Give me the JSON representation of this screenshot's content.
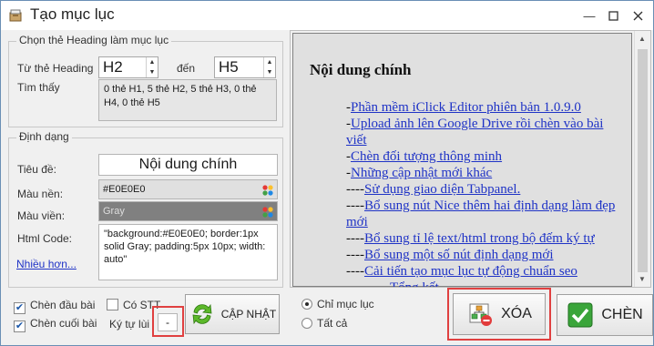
{
  "window": {
    "title": "Tạo mục lục",
    "minimize_icon": "minimize-icon",
    "maximize_icon": "maximize-icon",
    "close_icon": "close-icon"
  },
  "heading_group": {
    "legend": "Chọn thẻ Heading làm mục lục",
    "from_label": "Từ thẻ Heading",
    "from_value": "H2",
    "to_label": "đến",
    "to_value": "H5",
    "found_label": "Tìm thấy",
    "found_text": "0 thẻ H1, 5 thẻ H2, 5 thẻ H3, 0 thẻ H4, 0 thẻ H5"
  },
  "format_group": {
    "legend": "Định dạng",
    "title_label": "Tiêu đề:",
    "title_value": "Nội dung chính",
    "bg_label": "Màu nền:",
    "bg_value": "#E0E0E0",
    "border_label": "Màu viền:",
    "border_value": "Gray",
    "html_label": "Html Code:",
    "html_value": "\"background:#E0E0E0; border:1px solid Gray; padding:5px 10px; width: auto\"",
    "more_link": "Nhiều hơn..."
  },
  "options": {
    "insert_top": "Chèn đầu bài",
    "insert_top_checked": true,
    "has_stt": "Có STT",
    "has_stt_checked": false,
    "insert_bottom": "Chèn cuối bài",
    "insert_bottom_checked": true,
    "indent_label": "Ký tự lùi",
    "indent_value": "-"
  },
  "update_button": "CẬP NHẬT",
  "scope": {
    "only_toc": "Chỉ mục lục",
    "all": "Tất cả",
    "selected": "only_toc"
  },
  "delete_button": "XÓA",
  "insert_button": "CHÈN",
  "preview": {
    "title": "Nội dung chính",
    "items": [
      {
        "prefix": "-",
        "text": "Phần mềm iClick Editor phiên bản 1.0.9.0"
      },
      {
        "prefix": "-",
        "text": "Upload ảnh lên Google Drive rồi chèn vào bài viết"
      },
      {
        "prefix": "-",
        "text": "Chèn đối tượng thông minh"
      },
      {
        "prefix": "-",
        "text": "Những cập nhật mới khác"
      },
      {
        "prefix": "----",
        "text": "Sử dụng giao diện Tabpanel."
      },
      {
        "prefix": "----",
        "text": "Bổ sung nút Nice thêm hai định dạng làm đẹp mới"
      },
      {
        "prefix": "----",
        "text": "Bổ sung tỉ lệ text/html trong bộ đếm ký tự"
      },
      {
        "prefix": "----",
        "text": "Bổ sung một số nút định dạng mới"
      },
      {
        "prefix": "----",
        "text": "Cải tiến tạo mục lục tự động chuẩn seo"
      },
      {
        "prefix": "",
        "text": "Tổng kết"
      }
    ]
  },
  "colors": {
    "preview_bg": "#E0E0E0",
    "link": "#1f33c6",
    "highlight": "#e04040",
    "insert_check": "#3aa53a"
  }
}
